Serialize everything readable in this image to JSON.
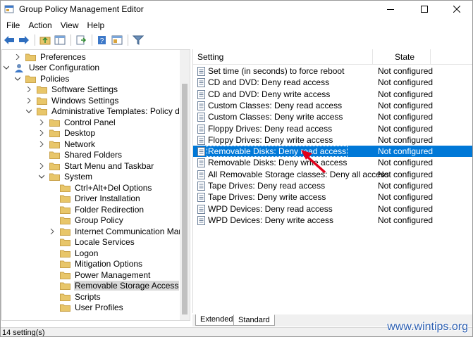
{
  "window": {
    "title": "Group Policy Management Editor",
    "controls": {
      "minimize": "minimize-icon",
      "maximize": "maximize-icon",
      "close": "close-icon"
    }
  },
  "menu": [
    "File",
    "Action",
    "View",
    "Help"
  ],
  "toolbar": {
    "buttons": [
      "back-icon",
      "forward-icon",
      "up-folder-icon",
      "show-hide-tree-icon",
      "export-list-icon",
      "help-icon",
      "properties-icon",
      "filter-icon"
    ]
  },
  "tree": {
    "items": [
      {
        "label": "Preferences",
        "level": 1,
        "expander": "right"
      },
      {
        "label": "User Configuration",
        "level": 0,
        "expander": "down",
        "icon": "user-config-icon"
      },
      {
        "label": "Policies",
        "level": 1,
        "expander": "down"
      },
      {
        "label": "Software Settings",
        "level": 2,
        "expander": "right"
      },
      {
        "label": "Windows Settings",
        "level": 2,
        "expander": "right"
      },
      {
        "label": "Administrative Templates: Policy definiti",
        "level": 2,
        "expander": "down"
      },
      {
        "label": "Control Panel",
        "level": 3,
        "expander": "right"
      },
      {
        "label": "Desktop",
        "level": 3,
        "expander": "right"
      },
      {
        "label": "Network",
        "level": 3,
        "expander": "right"
      },
      {
        "label": "Shared Folders",
        "level": 3,
        "expander": "none"
      },
      {
        "label": "Start Menu and Taskbar",
        "level": 3,
        "expander": "right"
      },
      {
        "label": "System",
        "level": 3,
        "expander": "down"
      },
      {
        "label": "Ctrl+Alt+Del Options",
        "level": 4,
        "expander": "none"
      },
      {
        "label": "Driver Installation",
        "level": 4,
        "expander": "none"
      },
      {
        "label": "Folder Redirection",
        "level": 4,
        "expander": "none"
      },
      {
        "label": "Group Policy",
        "level": 4,
        "expander": "none"
      },
      {
        "label": "Internet Communication Manage",
        "level": 4,
        "expander": "right"
      },
      {
        "label": "Locale Services",
        "level": 4,
        "expander": "none"
      },
      {
        "label": "Logon",
        "level": 4,
        "expander": "none"
      },
      {
        "label": "Mitigation Options",
        "level": 4,
        "expander": "none"
      },
      {
        "label": "Power Management",
        "level": 4,
        "expander": "none"
      },
      {
        "label": "Removable Storage Access",
        "level": 4,
        "expander": "none",
        "selected": true
      },
      {
        "label": "Scripts",
        "level": 4,
        "expander": "none"
      },
      {
        "label": "User Profiles",
        "level": 4,
        "expander": "none"
      }
    ]
  },
  "list": {
    "columns": {
      "setting": "Setting",
      "state": "State"
    },
    "rows": [
      {
        "setting": "Set time (in seconds) to force reboot",
        "state": "Not configured"
      },
      {
        "setting": "CD and DVD: Deny read access",
        "state": "Not configured"
      },
      {
        "setting": "CD and DVD: Deny write access",
        "state": "Not configured"
      },
      {
        "setting": "Custom Classes: Deny read access",
        "state": "Not configured"
      },
      {
        "setting": "Custom Classes: Deny write access",
        "state": "Not configured"
      },
      {
        "setting": "Floppy Drives: Deny read access",
        "state": "Not configured"
      },
      {
        "setting": "Floppy Drives: Deny write access",
        "state": "Not configured"
      },
      {
        "setting": "Removable Disks: Deny read access",
        "state": "Not configured",
        "selected": true
      },
      {
        "setting": "Removable Disks: Deny write access",
        "state": "Not configured"
      },
      {
        "setting": "All Removable Storage classes: Deny all access",
        "state": "Not configured"
      },
      {
        "setting": "Tape Drives: Deny read access",
        "state": "Not configured"
      },
      {
        "setting": "Tape Drives: Deny write access",
        "state": "Not configured"
      },
      {
        "setting": "WPD Devices: Deny read access",
        "state": "Not configured"
      },
      {
        "setting": "WPD Devices: Deny write access",
        "state": "Not configured"
      }
    ]
  },
  "tabs": [
    "Extended",
    "Standard"
  ],
  "active_tab": "Standard",
  "status": "14 setting(s)",
  "watermark": "www.wintips.org",
  "colors": {
    "selection": "#0078d7",
    "folder": "#e8c66a",
    "annotation_arrow": "#e3001b"
  }
}
